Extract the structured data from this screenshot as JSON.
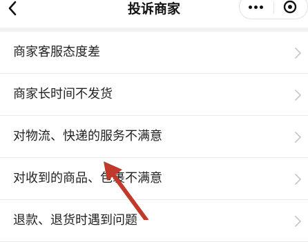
{
  "header": {
    "title": "投诉商家",
    "back_icon": "back-chevron-icon",
    "more_icon": "more-dots-icon",
    "close_icon": "target-circle-icon"
  },
  "complaint_options": [
    {
      "label": "商家客服态度差"
    },
    {
      "label": "商家长时间不发货"
    },
    {
      "label": "对物流、快递的服务不满意"
    },
    {
      "label": "对收到的商品、包裹不满意"
    },
    {
      "label": "退款、退货时遇到问题"
    }
  ],
  "colors": {
    "background": "#ffffff",
    "separator": "#f2f2f2",
    "annotation_arrow": "#c0392b"
  }
}
